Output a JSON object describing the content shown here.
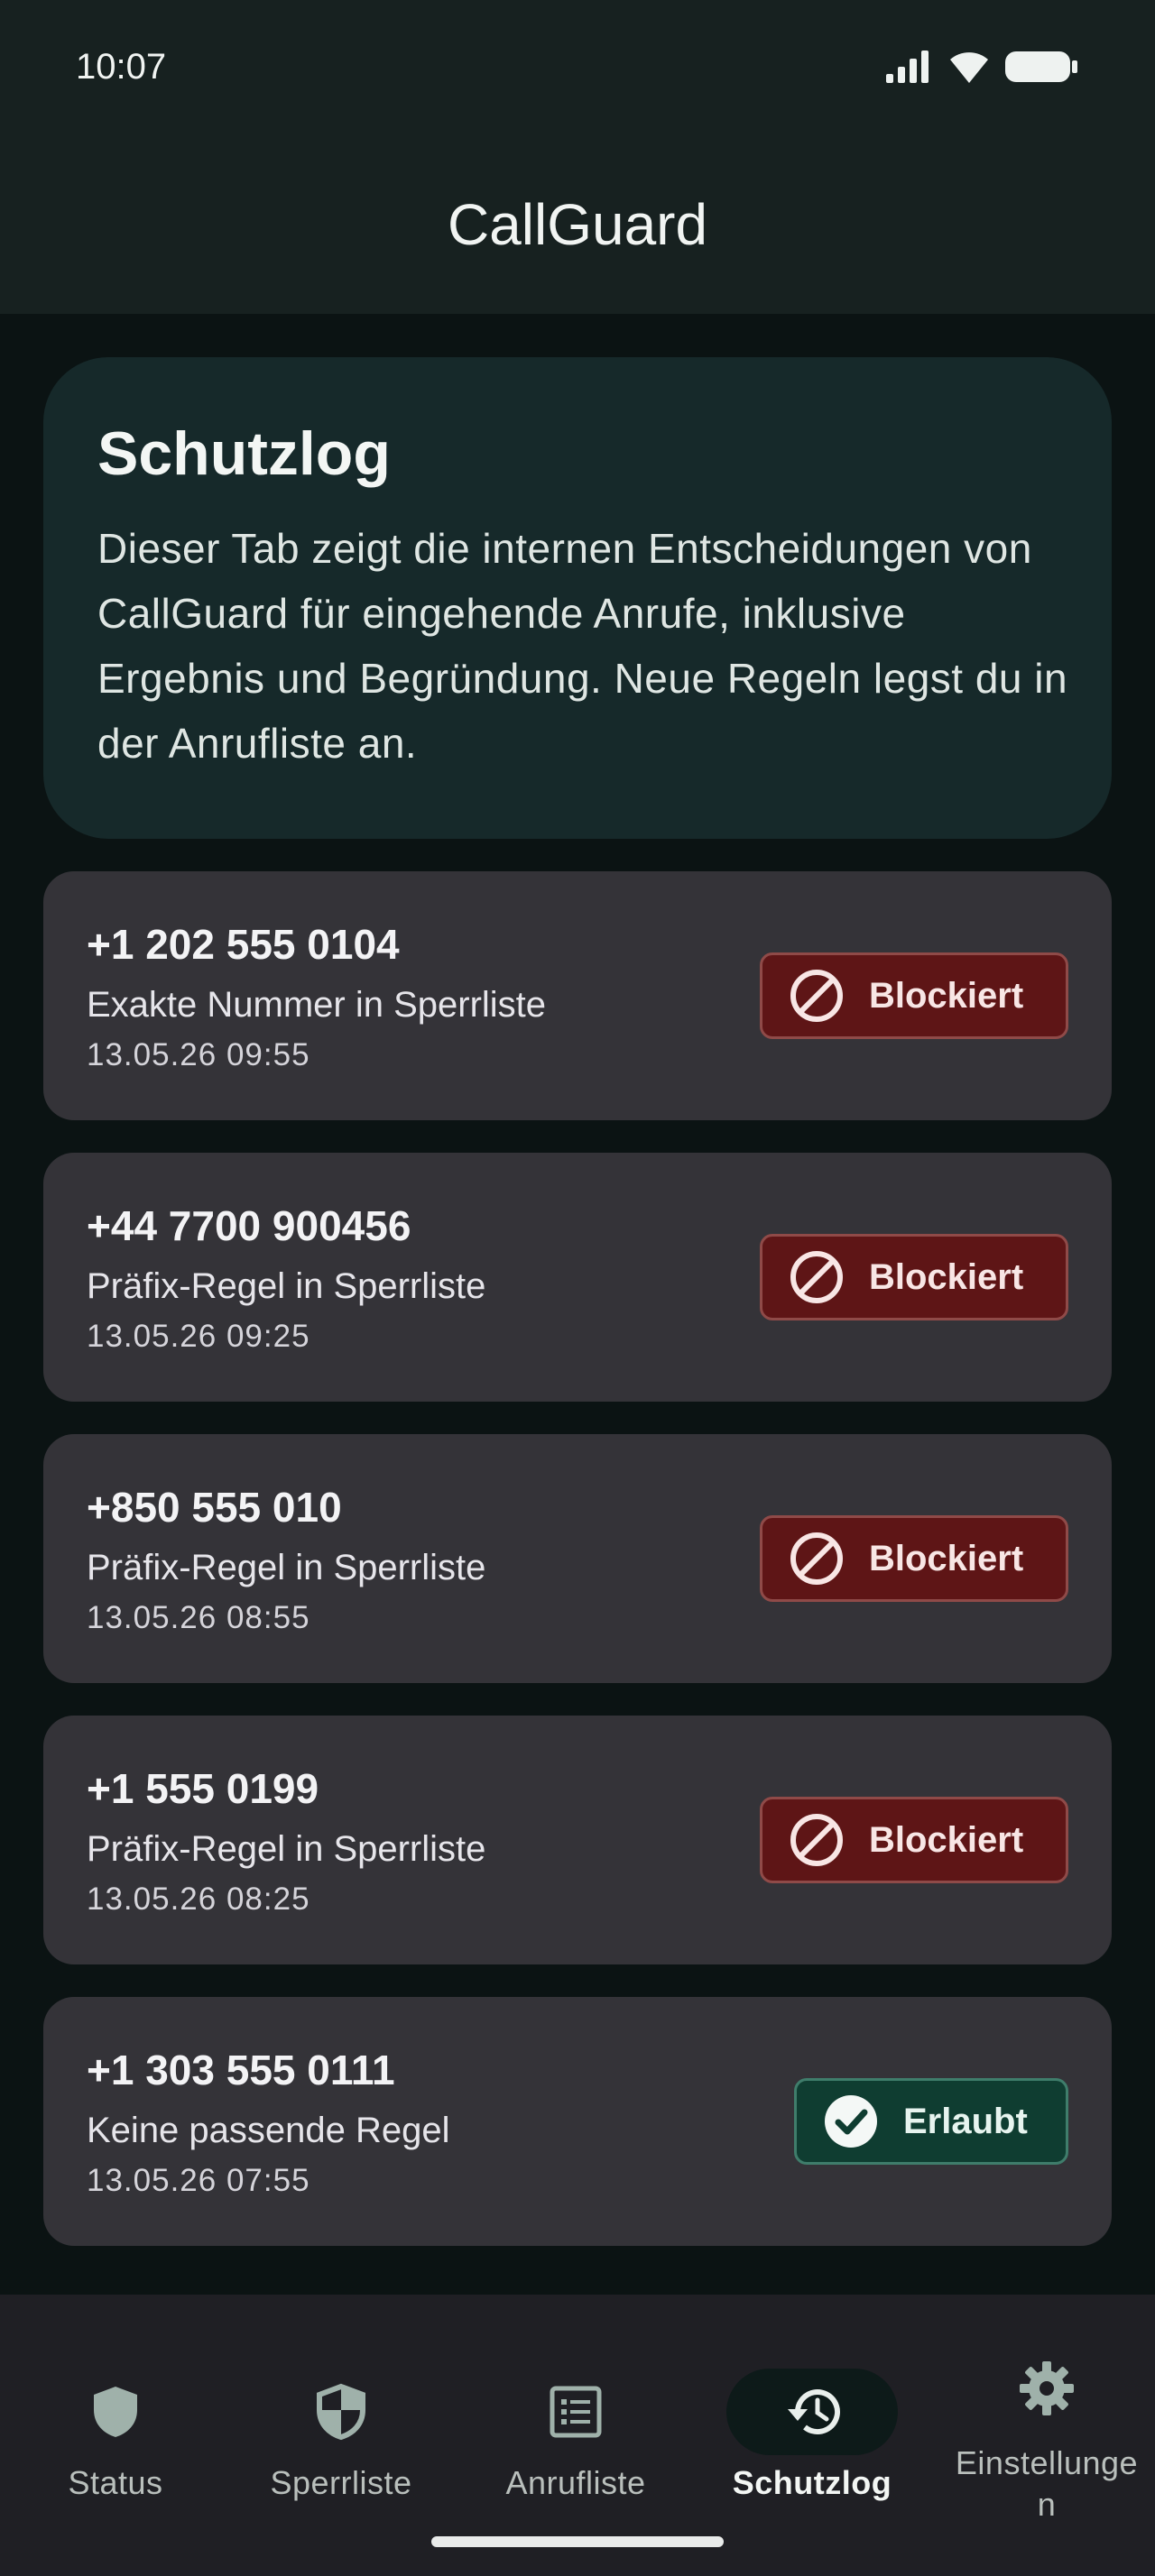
{
  "status_bar": {
    "time": "10:07"
  },
  "app_bar": {
    "title": "CallGuard"
  },
  "info": {
    "title": "Schutzlog",
    "text": "Dieser Tab zeigt die internen Entscheidungen von CallGuard für eingehende Anrufe, inklusive Ergebnis und Begründung. Neue Regeln legst du in der Anrufliste an."
  },
  "log": [
    {
      "number": "+1 202 555 0104",
      "reason": "Exakte Nummer in Sperrliste",
      "time": "13.05.26 09:55",
      "result": "Blockiert"
    },
    {
      "number": "+44 7700 900456",
      "reason": "Präfix-Regel in Sperrliste",
      "time": "13.05.26 09:25",
      "result": "Blockiert"
    },
    {
      "number": "+850 555 010",
      "reason": "Präfix-Regel in Sperrliste",
      "time": "13.05.26 08:55",
      "result": "Blockiert"
    },
    {
      "number": "+1 555 0199",
      "reason": "Präfix-Regel in Sperrliste",
      "time": "13.05.26 08:25",
      "result": "Blockiert"
    },
    {
      "number": "+1 303 555 0111",
      "reason": "Keine passende Regel",
      "time": "13.05.26 07:55",
      "result": "Erlaubt"
    }
  ],
  "nav": [
    {
      "label": "Status",
      "icon": "shield-icon"
    },
    {
      "label": "Sperrliste",
      "icon": "shield-half-icon"
    },
    {
      "label": "Anrufliste",
      "icon": "list-icon"
    },
    {
      "label": "Schutzlog",
      "icon": "history-icon",
      "active": true
    },
    {
      "label": "Einstellunge\nn",
      "icon": "gear-icon"
    }
  ],
  "colors": {
    "background": "#0b1313",
    "surface": "#172120",
    "info_card": "#16292a",
    "log_card": "#343338",
    "blocked": "#5e1516",
    "allowed": "#0f3d31"
  }
}
